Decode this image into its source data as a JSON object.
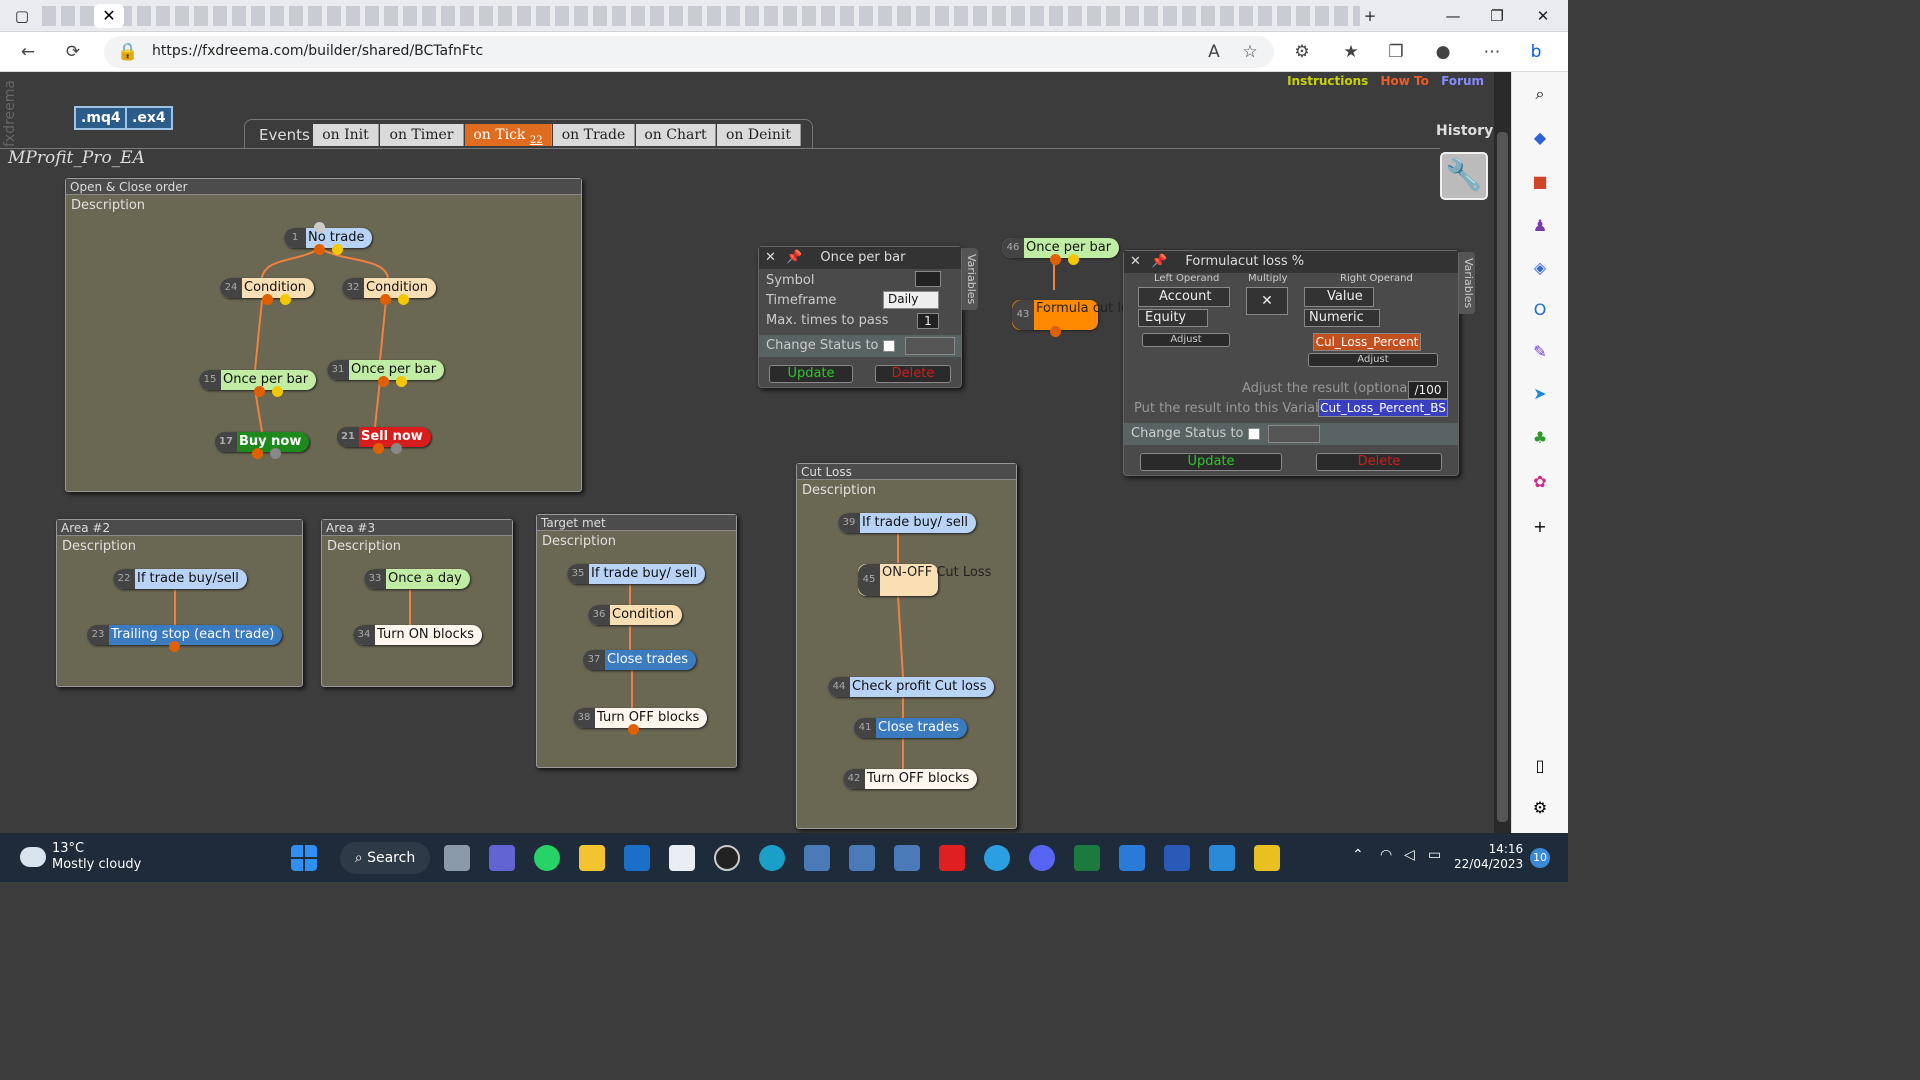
{
  "browser": {
    "url": "https://fxdreema.com/builder/shared/BCTafnFtc",
    "active_tab_close": "✕",
    "new_tab": "+",
    "minimize": "—",
    "maximize": "❐",
    "close": "✕"
  },
  "app": {
    "logo_text": "fxdreema",
    "links": {
      "instructions": "Instructions",
      "howto": "How To",
      "forum": "Forum"
    },
    "buttons": {
      "mq4": ".mq4",
      "ex4": ".ex4"
    },
    "events_label": "Events",
    "event_tabs": [
      "on Init",
      "on Timer",
      "on Tick",
      "on Trade",
      "on Chart",
      "on Deinit"
    ],
    "on_tick_count": "22",
    "history": "History",
    "project_name": "MProfit_Pro_EA"
  },
  "areas": {
    "open_close": {
      "title": "Open & Close order",
      "desc": "Description"
    },
    "area2": {
      "title": "Area #2",
      "desc": "Description"
    },
    "area3": {
      "title": "Area #3",
      "desc": "Description"
    },
    "target": {
      "title": "Target met",
      "desc": "Description"
    },
    "cutloss": {
      "title": "Cut Loss",
      "desc": "Description"
    }
  },
  "blocks": {
    "b1": {
      "num": "1",
      "label": "No trade"
    },
    "b24": {
      "num": "24",
      "label": "Condition"
    },
    "b32": {
      "num": "32",
      "label": "Condition"
    },
    "b15": {
      "num": "15",
      "label": "Once per bar"
    },
    "b31": {
      "num": "31",
      "label": "Once per bar"
    },
    "b17": {
      "num": "17",
      "label": "Buy now"
    },
    "b21": {
      "num": "21",
      "label": "Sell now"
    },
    "b22": {
      "num": "22",
      "label": "If trade buy/sell"
    },
    "b23": {
      "num": "23",
      "label": "Trailing stop (each trade)"
    },
    "b33": {
      "num": "33",
      "label": "Once a day"
    },
    "b34": {
      "num": "34",
      "label": "Turn ON blocks"
    },
    "b35": {
      "num": "35",
      "label": "If trade buy/ sell"
    },
    "b36": {
      "num": "36",
      "label": "Condition"
    },
    "b37": {
      "num": "37",
      "label": "Close trades"
    },
    "b38": {
      "num": "38",
      "label": "Turn OFF blocks"
    },
    "b39": {
      "num": "39",
      "label": "If trade buy/ sell"
    },
    "b45": {
      "num": "45",
      "label": "ON-OFF Cut Loss"
    },
    "b44": {
      "num": "44",
      "label": "Check profit Cut loss"
    },
    "b41": {
      "num": "41",
      "label": "Close trades"
    },
    "b42": {
      "num": "42",
      "label": "Turn OFF blocks"
    },
    "b46": {
      "num": "46",
      "label": "Once per bar"
    },
    "b43": {
      "num": "43",
      "label": "Formula cut loss %"
    }
  },
  "panel_once": {
    "title": "Once per bar",
    "symbol_label": "Symbol",
    "timeframe_label": "Timeframe",
    "timeframe_value": "Daily",
    "max_label": "Max. times to pass",
    "max_value": "1",
    "status_label": "Change Status to",
    "update": "Update",
    "delete": "Delete",
    "variables": "Variables"
  },
  "panel_formula": {
    "title": "Formulacut loss %",
    "left_operand": "Left Operand",
    "multiply": "Multiply",
    "right_operand": "Right Operand",
    "left_select": "Account",
    "left_sub": "Equity",
    "adjust": "Adjust",
    "op": "✕",
    "right_select": "Value",
    "right_sub": "Numeric",
    "right_var": "Cul_Loss_Percent",
    "adjust_result_label": "Adjust the result (optional):",
    "adjust_result_value": "/100",
    "put_result_label": "Put the result into this Variable:",
    "put_result_value": "Cut_Loss_Percent_BS",
    "status_label": "Change Status to",
    "update": "Update",
    "delete": "Delete",
    "variables": "Variables"
  },
  "taskbar": {
    "temp": "13°C",
    "weather": "Mostly cloudy",
    "search": "Search",
    "time": "14:16",
    "date": "22/04/2023",
    "notif": "10"
  },
  "colors": {
    "canvas": "#3c3c3c",
    "area": "#6a6752",
    "active_tab": "#e06d1f",
    "connector": "#e06000"
  }
}
